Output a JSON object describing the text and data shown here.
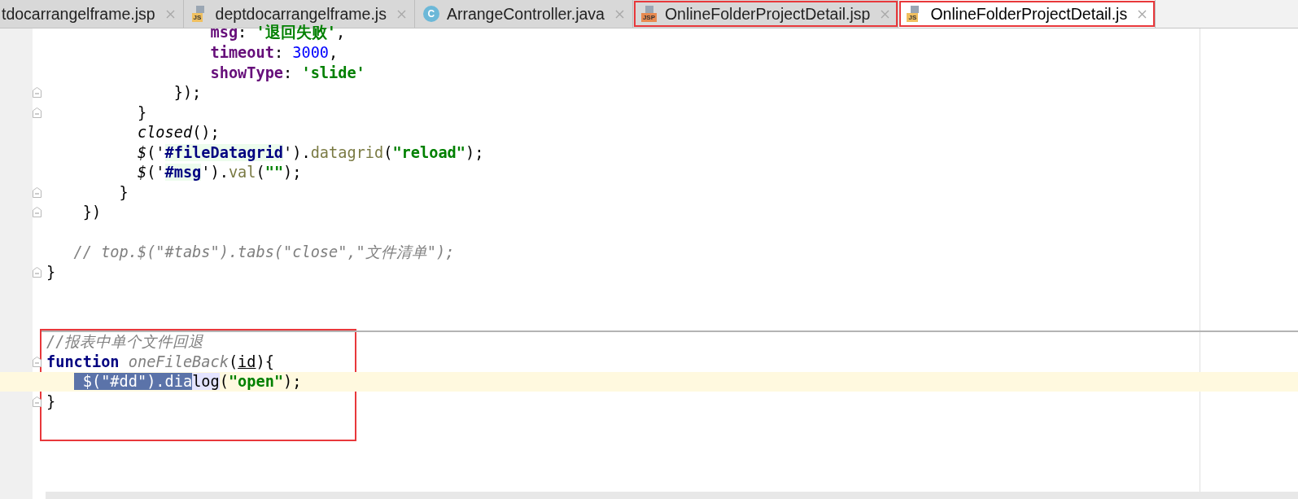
{
  "tabs": [
    {
      "label": "tdocarrangelframe.jsp",
      "kind": "none",
      "selected": false,
      "annotated": false
    },
    {
      "label": "deptdocarrangelframe.js",
      "kind": "js",
      "icon_label": "JS",
      "selected": false,
      "annotated": false
    },
    {
      "label": "ArrangeController.java",
      "kind": "class",
      "icon_label": "C",
      "selected": false,
      "annotated": false
    },
    {
      "label": "OnlineFolderProjectDetail.jsp",
      "kind": "jsp",
      "icon_label": "JSP",
      "selected": false,
      "annotated": true
    },
    {
      "label": "OnlineFolderProjectDetail.js",
      "kind": "js",
      "icon_label": "JS",
      "selected": true,
      "annotated": true
    }
  ],
  "lines": [
    {
      "fold": false,
      "current": false,
      "separator": false,
      "boxed": false,
      "tokens": [
        {
          "text": "                  msg",
          "kind": "prop"
        },
        {
          "text": ": ",
          "kind": "plain"
        },
        {
          "text": "'退回失败'",
          "kind": "str"
        },
        {
          "text": ",",
          "kind": "plain"
        }
      ]
    },
    {
      "fold": false,
      "current": false,
      "separator": false,
      "boxed": false,
      "tokens": [
        {
          "text": "                  timeout",
          "kind": "prop"
        },
        {
          "text": ": ",
          "kind": "plain"
        },
        {
          "text": "3000",
          "kind": "num"
        },
        {
          "text": ",",
          "kind": "plain"
        }
      ]
    },
    {
      "fold": false,
      "current": false,
      "separator": false,
      "boxed": false,
      "tokens": [
        {
          "text": "                  showType",
          "kind": "prop"
        },
        {
          "text": ": ",
          "kind": "plain"
        },
        {
          "text": "'slide'",
          "kind": "str"
        }
      ]
    },
    {
      "fold": true,
      "current": false,
      "separator": false,
      "boxed": false,
      "tokens": [
        {
          "text": "              });",
          "kind": "plain"
        }
      ]
    },
    {
      "fold": true,
      "current": false,
      "separator": false,
      "boxed": false,
      "tokens": [
        {
          "text": "          }",
          "kind": "plain"
        }
      ]
    },
    {
      "fold": false,
      "current": false,
      "separator": false,
      "boxed": false,
      "tokens": [
        {
          "text": "          closed",
          "kind": "call"
        },
        {
          "text": "();",
          "kind": "plain"
        }
      ]
    },
    {
      "fold": false,
      "current": false,
      "separator": false,
      "boxed": false,
      "tokens": [
        {
          "text": "          $",
          "kind": "call"
        },
        {
          "text": "('",
          "kind": "plain"
        },
        {
          "text": "#fileDatagrid",
          "kind": "selector"
        },
        {
          "text": "')",
          "kind": "plain"
        },
        {
          "text": ".",
          "kind": "plain"
        },
        {
          "text": "datagrid",
          "kind": "method"
        },
        {
          "text": "(",
          "kind": "plain"
        },
        {
          "text": "\"reload\"",
          "kind": "str"
        },
        {
          "text": ");",
          "kind": "plain"
        }
      ]
    },
    {
      "fold": false,
      "current": false,
      "separator": false,
      "boxed": false,
      "tokens": [
        {
          "text": "          $",
          "kind": "call"
        },
        {
          "text": "('",
          "kind": "plain"
        },
        {
          "text": "#msg",
          "kind": "selector"
        },
        {
          "text": "')",
          "kind": "plain"
        },
        {
          "text": ".",
          "kind": "plain"
        },
        {
          "text": "val",
          "kind": "method"
        },
        {
          "text": "(",
          "kind": "plain"
        },
        {
          "text": "\"\"",
          "kind": "str"
        },
        {
          "text": ");",
          "kind": "plain"
        }
      ]
    },
    {
      "fold": true,
      "current": false,
      "separator": false,
      "boxed": false,
      "tokens": [
        {
          "text": "        }",
          "kind": "plain"
        }
      ]
    },
    {
      "fold": true,
      "current": false,
      "separator": false,
      "boxed": false,
      "tokens": [
        {
          "text": "    })",
          "kind": "plain"
        }
      ]
    },
    {
      "fold": false,
      "current": false,
      "separator": false,
      "boxed": false
    },
    {
      "fold": false,
      "current": false,
      "separator": false,
      "boxed": false,
      "tokens": [
        {
          "text": "   // top.$(\"#tabs\").tabs(\"close\",\"文件清单\");",
          "kind": "comment"
        }
      ]
    },
    {
      "fold": true,
      "current": false,
      "separator": false,
      "boxed": false,
      "tokens": [
        {
          "text": "}",
          "kind": "plain"
        }
      ]
    },
    {
      "fold": false,
      "current": false,
      "separator": false,
      "boxed": false
    },
    {
      "fold": false,
      "current": false,
      "separator": false,
      "boxed": false
    },
    {
      "fold": false,
      "current": false,
      "separator": true,
      "boxed": true,
      "tokens": [
        {
          "text": "//报表中单个文件回退",
          "kind": "comment"
        }
      ]
    },
    {
      "fold": true,
      "current": false,
      "separator": false,
      "boxed": true,
      "tokens": [
        {
          "text": "function",
          "kind": "kw"
        },
        {
          "text": " oneFileBack",
          "kind": "decl"
        },
        {
          "text": "(",
          "kind": "plain"
        },
        {
          "text": "id",
          "kind": "param"
        },
        {
          "text": "){",
          "kind": "plain"
        }
      ]
    },
    {
      "fold": false,
      "current": true,
      "separator": false,
      "boxed": true,
      "tokens": [
        {
          "text": "    $(\"#dd\").dia",
          "kind": "selection"
        },
        {
          "text": "log",
          "kind": "usage"
        },
        {
          "text": "(",
          "kind": "plain"
        },
        {
          "text": "\"open\"",
          "kind": "str"
        },
        {
          "text": ");",
          "kind": "plain"
        }
      ]
    },
    {
      "fold": true,
      "current": false,
      "separator": false,
      "boxed": true,
      "tokens": [
        {
          "text": "}",
          "kind": "plain"
        }
      ]
    }
  ]
}
